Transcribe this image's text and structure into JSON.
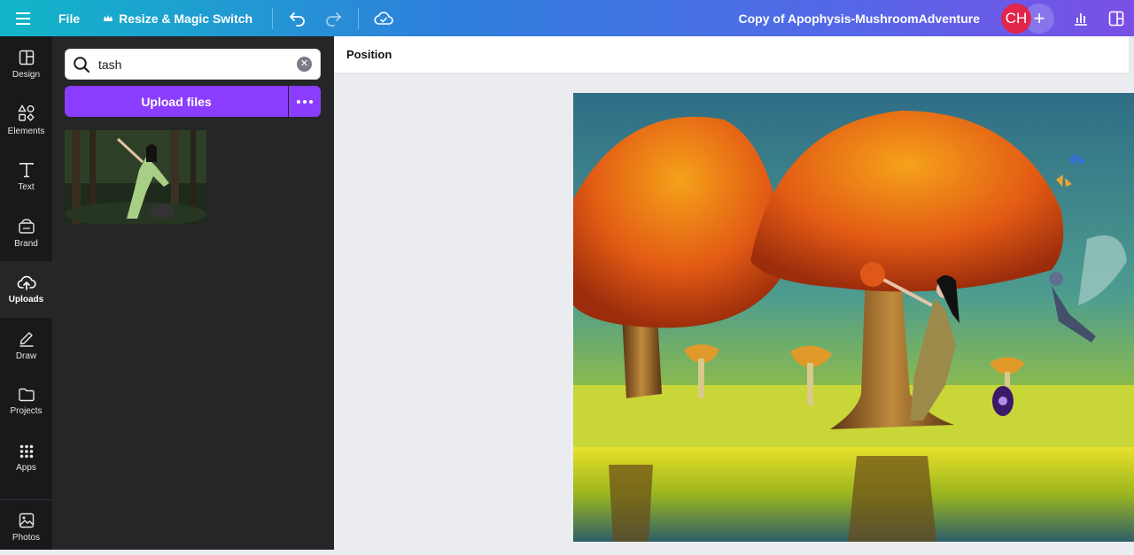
{
  "topbar": {
    "menu_icon": "hamburger-icon",
    "file_label": "File",
    "resize_label": "Resize & Magic Switch",
    "resize_icon": "crown-icon",
    "undo_icon": "undo-icon",
    "redo_icon": "redo-icon",
    "save_icon": "cloud-check-icon",
    "doc_title": "Copy of Apophysis-MushroomAdventure",
    "avatar_initials": "CH",
    "add_collaborator": "+",
    "insights_icon": "bar-chart-icon",
    "present_icon": "layout-icon"
  },
  "rail": {
    "items": [
      {
        "label": "Design",
        "icon": "design-icon"
      },
      {
        "label": "Elements",
        "icon": "elements-icon"
      },
      {
        "label": "Text",
        "icon": "text-icon"
      },
      {
        "label": "Brand",
        "icon": "brand-icon"
      },
      {
        "label": "Uploads",
        "icon": "upload-cloud-icon",
        "active": true
      },
      {
        "label": "Draw",
        "icon": "draw-icon"
      },
      {
        "label": "Projects",
        "icon": "folder-icon"
      },
      {
        "label": "Apps",
        "icon": "apps-grid-icon"
      },
      {
        "label": "Photos",
        "icon": "photo-icon"
      }
    ]
  },
  "panel": {
    "search": {
      "value": "tash"
    },
    "upload_label": "Upload files",
    "more_icon": "more-horizontal-icon"
  },
  "toolbar": {
    "position_label": "Position"
  },
  "colors": {
    "accent": "#8b3dff",
    "avatar": "#e2264b",
    "rail_bg": "#18191b",
    "panel_bg": "#252627"
  }
}
